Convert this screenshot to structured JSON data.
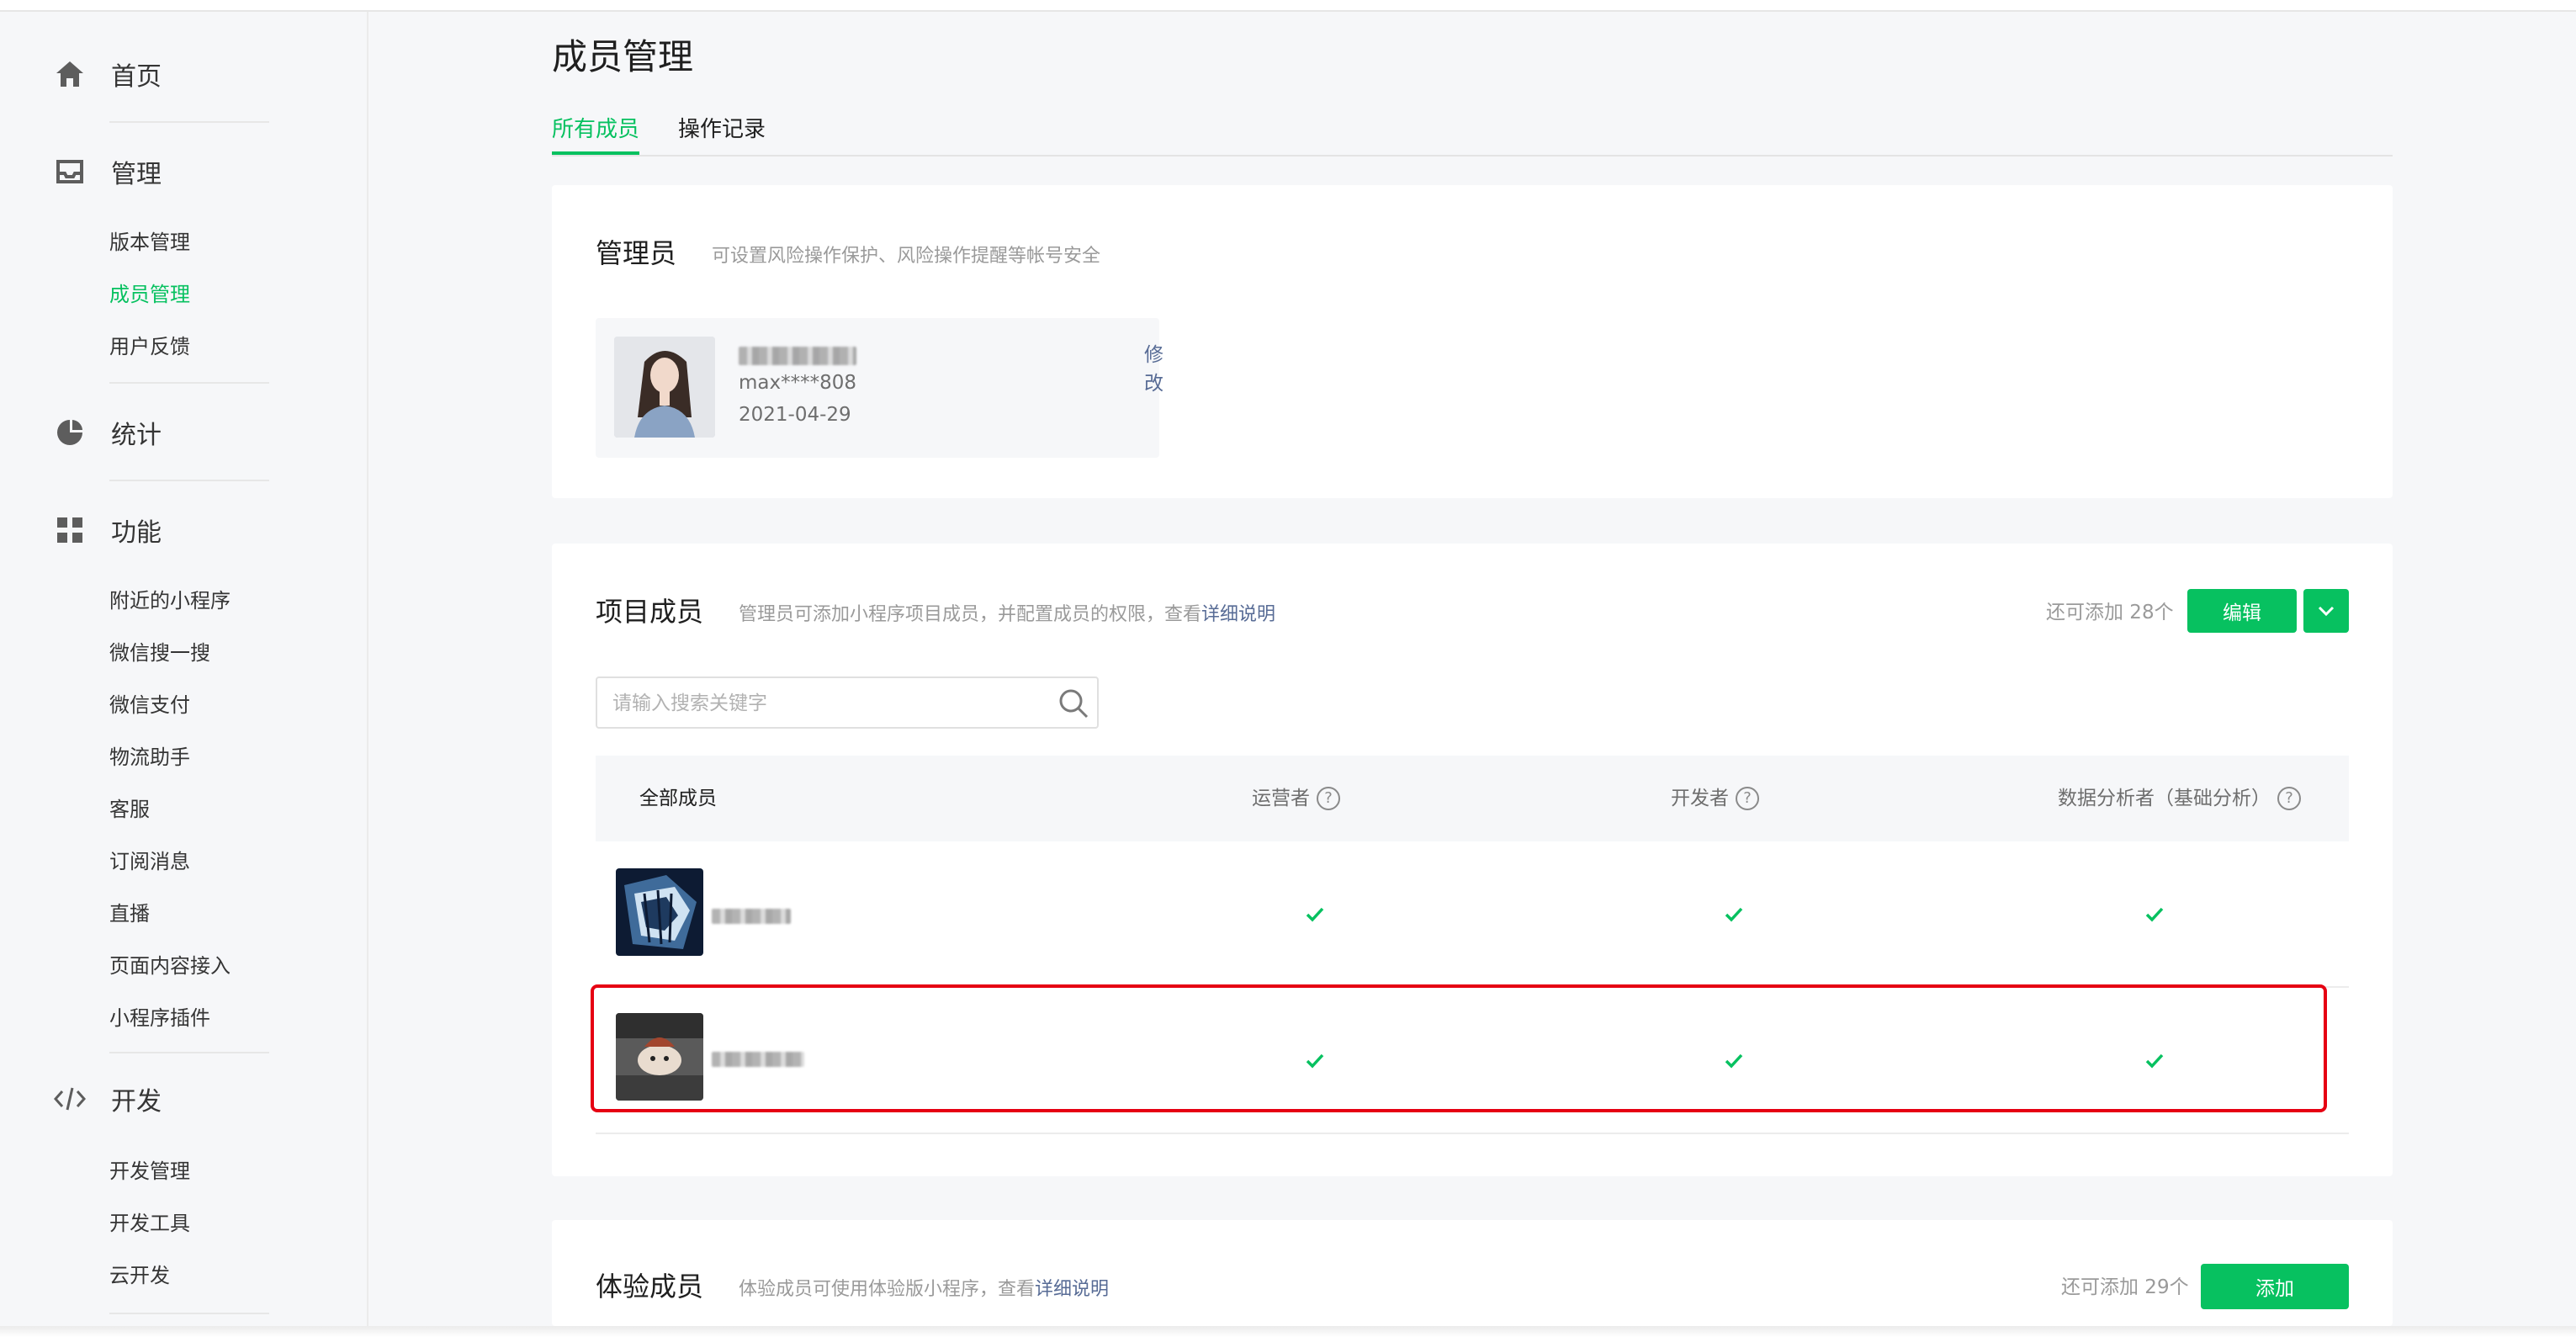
{
  "sidebar": {
    "home": {
      "label": "首页",
      "icon": "home-icon"
    },
    "manage": {
      "label": "管理",
      "icon": "inbox-icon",
      "items": [
        {
          "label": "版本管理",
          "active": false
        },
        {
          "label": "成员管理",
          "active": true
        },
        {
          "label": "用户反馈",
          "active": false
        }
      ]
    },
    "stats": {
      "label": "统计",
      "icon": "pie-chart-icon"
    },
    "features": {
      "label": "功能",
      "icon": "grid-icon",
      "items": [
        {
          "label": "附近的小程序"
        },
        {
          "label": "微信搜一搜"
        },
        {
          "label": "微信支付"
        },
        {
          "label": "物流助手"
        },
        {
          "label": "客服"
        },
        {
          "label": "订阅消息"
        },
        {
          "label": "直播"
        },
        {
          "label": "页面内容接入"
        },
        {
          "label": "小程序插件"
        }
      ]
    },
    "dev": {
      "label": "开发",
      "icon": "code-icon",
      "items": [
        {
          "label": "开发管理"
        },
        {
          "label": "开发工具"
        },
        {
          "label": "云开发"
        }
      ]
    }
  },
  "page": {
    "title": "成员管理"
  },
  "tabs": [
    {
      "label": "所有成员",
      "active": true
    },
    {
      "label": "操作记录",
      "active": false
    }
  ],
  "admin_section": {
    "title": "管理员",
    "desc": "可设置风险操作保护、风险操作提醒等帐号安全",
    "admin": {
      "account": "max****808",
      "date": "2021-04-29",
      "edit_label": "修改"
    }
  },
  "project_section": {
    "title": "项目成员",
    "desc_prefix": "管理员可添加小程序项目成员，并配置成员的权限，查看",
    "desc_link": "详细说明",
    "remaining": "还可添加 28个",
    "edit_button": "编辑",
    "search_placeholder": "请输入搜索关键字",
    "columns": {
      "all_members": "全部成员",
      "operator": "运营者",
      "developer": "开发者",
      "analyst": "数据分析者（基础分析）"
    },
    "rows": [
      {
        "operator": true,
        "developer": true,
        "analyst": true
      },
      {
        "operator": true,
        "developer": true,
        "analyst": true
      }
    ]
  },
  "trial_section": {
    "title": "体验成员",
    "desc_prefix": "体验成员可使用体验版小程序，查看",
    "desc_link": "详细说明",
    "remaining": "还可添加 29个",
    "add_button": "添加"
  },
  "colors": {
    "accent": "#07c160",
    "link": "#576b95",
    "highlight_border": "#e60012"
  }
}
